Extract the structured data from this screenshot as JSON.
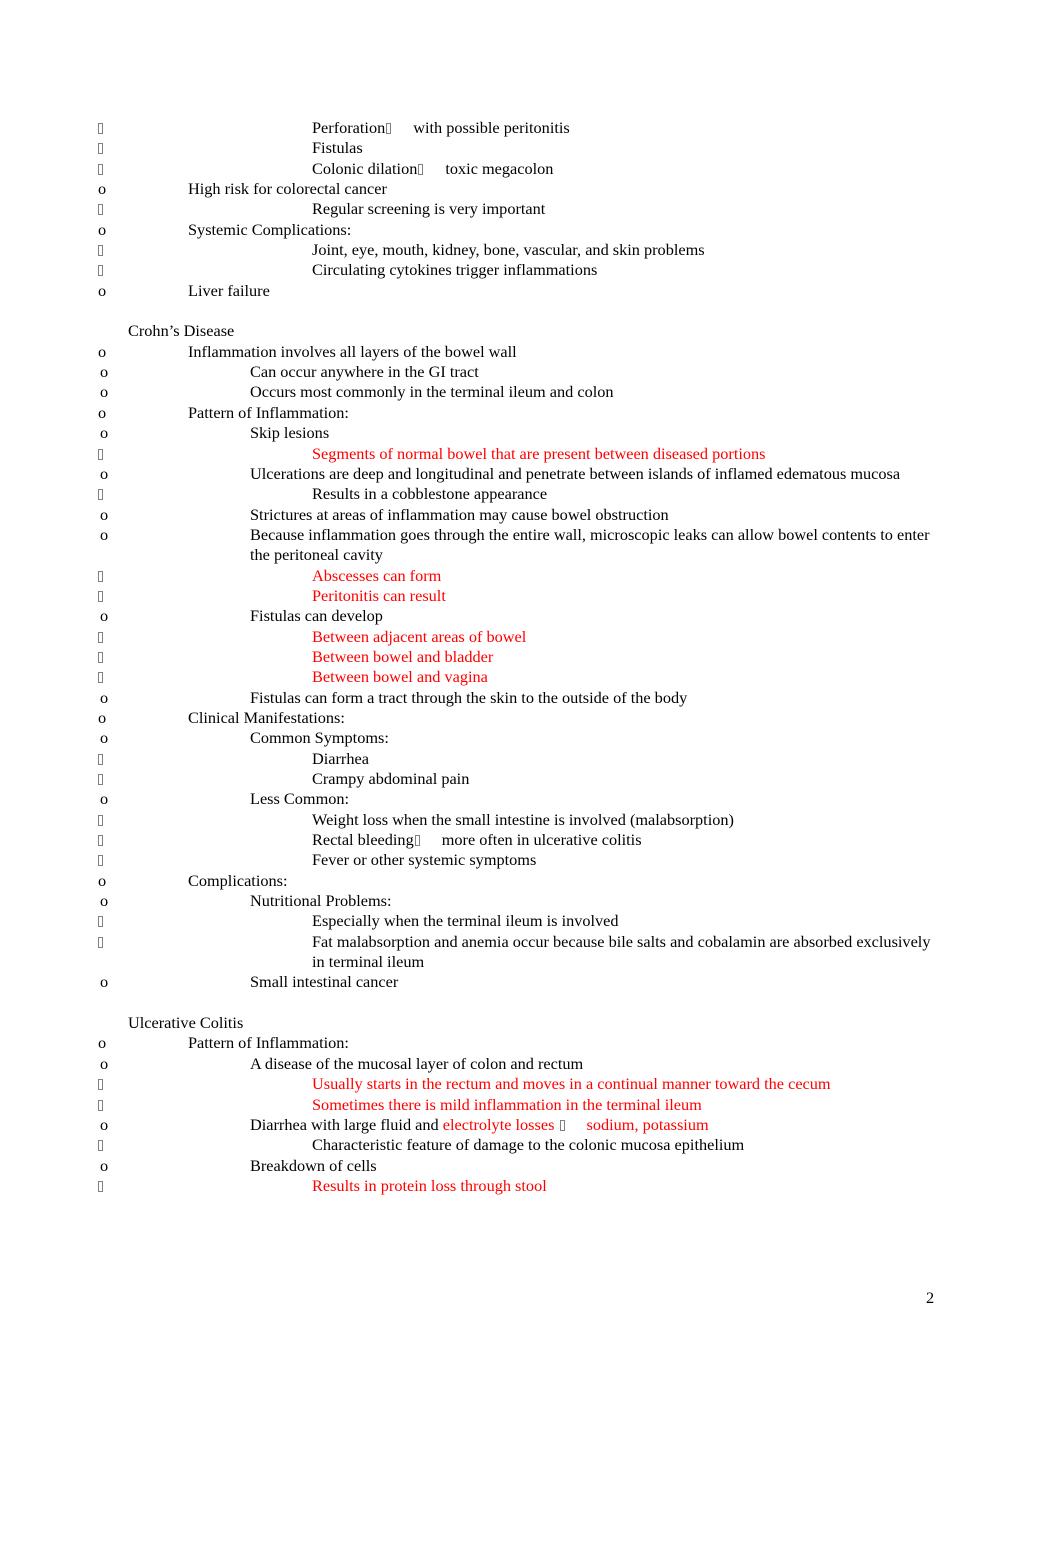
{
  "document": {
    "page_number": "2",
    "accent_red": "#FF0000",
    "text_color": "#000000",
    "bullet_glyph_color": "#808080"
  },
  "content": {
    "top_section_lines": [
      {
        "level": 3,
        "marker": "box",
        "text": "Perforation",
        "inline_arrow": true,
        "text_after": "with possible peritonitis",
        "color": "black"
      },
      {
        "level": 3,
        "marker": "box",
        "text": "Fistulas",
        "color": "black"
      },
      {
        "level": 3,
        "marker": "box",
        "text": "Colonic dilation",
        "inline_arrow": true,
        "text_after": "toxic megacolon",
        "color": "black"
      },
      {
        "level": 1,
        "marker": "o",
        "text": "High risk for colorectal cancer",
        "color": "black"
      },
      {
        "level": 3,
        "marker": "box",
        "text": "Regular screening is very important",
        "color": "black"
      },
      {
        "level": 1,
        "marker": "o",
        "text": "Systemic Complications:",
        "color": "black"
      },
      {
        "level": 3,
        "marker": "box",
        "text": "Joint, eye, mouth, kidney, bone, vascular, and skin problems",
        "color": "black"
      },
      {
        "level": 3,
        "marker": "box",
        "text": "Circulating cytokines trigger inflammations",
        "color": "black"
      },
      {
        "level": 1,
        "marker": "o",
        "text": "Liver failure",
        "color": "black"
      }
    ],
    "crohns": {
      "heading": "Crohn’s Disease",
      "lines": [
        {
          "level": 1,
          "marker": "o",
          "text": "Inflammation involves all layers of the bowel wall",
          "color": "black"
        },
        {
          "level": 2,
          "marker": "o",
          "text": "Can occur anywhere in the GI tract",
          "color": "black"
        },
        {
          "level": 2,
          "marker": "o",
          "text": "Occurs most commonly in the terminal ileum and colon",
          "color": "black"
        },
        {
          "level": 1,
          "marker": "o",
          "text": "Pattern of Inflammation:",
          "color": "black"
        },
        {
          "level": 2,
          "marker": "o",
          "text": "Skip lesions",
          "color": "black"
        },
        {
          "level": 3,
          "marker": "box",
          "text": "Segments of normal bowel that are present between diseased portions",
          "color": "red"
        },
        {
          "level": 2,
          "marker": "o",
          "text": "Ulcerations are deep and longitudinal and penetrate between islands of inflamed edematous mucosa",
          "color": "black"
        },
        {
          "level": 3,
          "marker": "box",
          "text": "Results in a cobblestone appearance",
          "color": "black"
        },
        {
          "level": 2,
          "marker": "o",
          "text": "Strictures at areas of inflammation may cause bowel obstruction",
          "color": "black"
        },
        {
          "level": 2,
          "marker": "o",
          "text": "Because inflammation goes through the entire wall, microscopic leaks can allow bowel contents to enter the peritoneal cavity",
          "color": "black"
        },
        {
          "level": 3,
          "marker": "box",
          "text": "Abscesses can form",
          "color": "red"
        },
        {
          "level": 3,
          "marker": "box",
          "text": "Peritonitis can result",
          "color": "red"
        },
        {
          "level": 2,
          "marker": "o",
          "text": "Fistulas can develop",
          "color": "black"
        },
        {
          "level": 3,
          "marker": "box",
          "text": "Between adjacent areas of bowel",
          "color": "red"
        },
        {
          "level": 3,
          "marker": "box",
          "text": "Between bowel and bladder",
          "color": "red"
        },
        {
          "level": 3,
          "marker": "box",
          "text": "Between bowel and vagina",
          "color": "red"
        },
        {
          "level": 2,
          "marker": "o",
          "text": "Fistulas can form a tract through the skin to the outside of the body",
          "color": "black"
        },
        {
          "level": 1,
          "marker": "o",
          "text": "Clinical Manifestations:",
          "color": "black"
        },
        {
          "level": 2,
          "marker": "o",
          "text": "Common Symptoms:",
          "color": "black"
        },
        {
          "level": 3,
          "marker": "box",
          "text": "Diarrhea",
          "color": "black"
        },
        {
          "level": 3,
          "marker": "box",
          "text": "Crampy abdominal pain",
          "color": "black"
        },
        {
          "level": 2,
          "marker": "o",
          "text": "Less Common:",
          "color": "black"
        },
        {
          "level": 3,
          "marker": "box",
          "text": "Weight loss when the small intestine is involved (malabsorption)",
          "color": "black"
        },
        {
          "level": 3,
          "marker": "box",
          "text": "Rectal bleeding",
          "inline_arrow": true,
          "text_after": "more often in ulcerative colitis",
          "color": "black"
        },
        {
          "level": 3,
          "marker": "box",
          "text": "Fever or other systemic symptoms",
          "color": "black"
        },
        {
          "level": 1,
          "marker": "o",
          "text": "Complications:",
          "color": "black"
        },
        {
          "level": 2,
          "marker": "o",
          "text": "Nutritional Problems:",
          "color": "black"
        },
        {
          "level": 3,
          "marker": "box",
          "text": "Especially when the terminal ileum is involved",
          "color": "black"
        },
        {
          "level": 3,
          "marker": "box",
          "text": "Fat malabsorption and anemia occur because bile salts and cobalamin are absorbed exclusively in terminal ileum",
          "color": "black"
        },
        {
          "level": 2,
          "marker": "o",
          "text": "Small intestinal cancer",
          "color": "black"
        }
      ]
    },
    "ulcerative_colitis": {
      "heading": "Ulcerative Colitis",
      "lines": [
        {
          "level": 1,
          "marker": "o",
          "text": "Pattern of Inflammation:",
          "color": "black"
        },
        {
          "level": 2,
          "marker": "o",
          "text": "A disease of the mucosal layer of colon and rectum",
          "color": "black"
        },
        {
          "level": 3,
          "marker": "box",
          "text": "Usually starts in the rectum and moves in a continual manner toward the cecum",
          "color": "red"
        },
        {
          "level": 3,
          "marker": "box",
          "text": "Sometimes there is mild inflammation in the terminal ileum",
          "color": "red"
        },
        {
          "level": 2,
          "marker": "o",
          "text": "Diarrhea with large fluid and ",
          "text_red": "electrolyte losses",
          "inline_arrow_red": true,
          "text_red_after": "sodium, potassium",
          "color": "mixed"
        },
        {
          "level": 3,
          "marker": "box",
          "text": "Characteristic feature of damage to the colonic mucosa epithelium",
          "color": "black"
        },
        {
          "level": 2,
          "marker": "o",
          "text": "Breakdown of cells",
          "color": "black"
        },
        {
          "level": 3,
          "marker": "box",
          "text": "Results in protein loss through stool",
          "color": "red"
        }
      ]
    }
  }
}
